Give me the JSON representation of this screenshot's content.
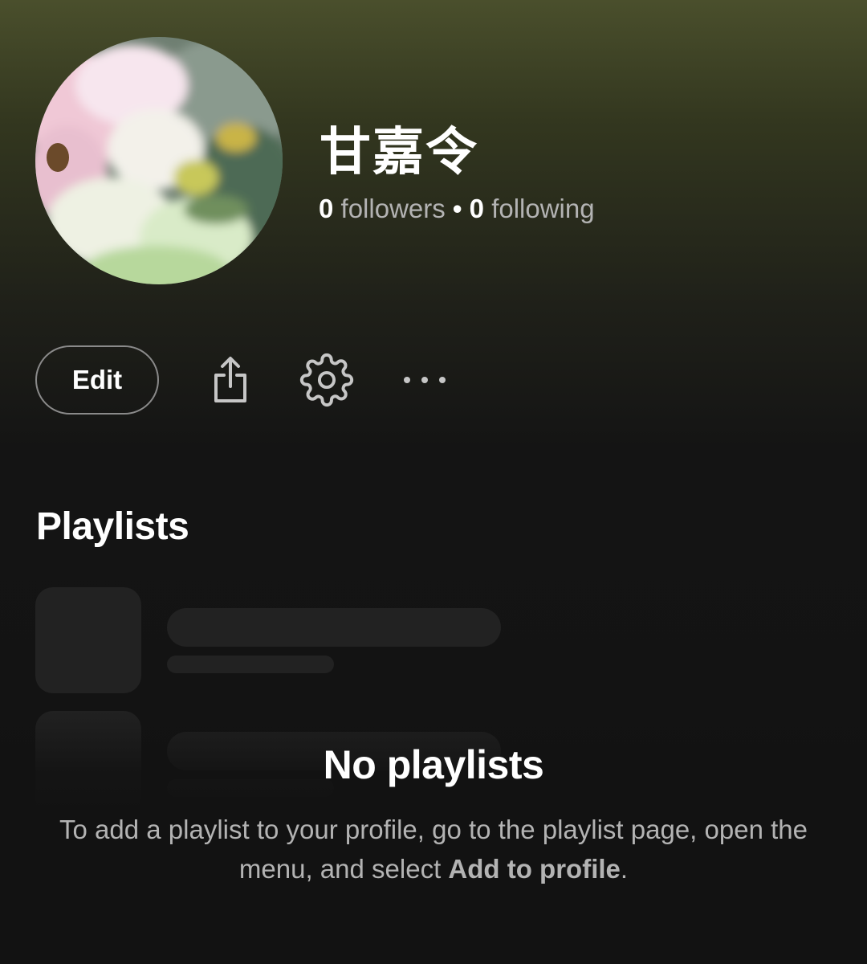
{
  "profile": {
    "display_name": "甘嘉令",
    "followers_count": "0",
    "followers_label": "followers",
    "separator": "•",
    "following_count": "0",
    "following_label": "following",
    "avatar_description_icon": "flower-photo-avatar"
  },
  "actions": {
    "edit_label": "Edit",
    "share_icon": "share-icon",
    "settings_icon": "gear-icon",
    "more_icon": "more-horizontal-icon"
  },
  "playlists": {
    "title": "Playlists",
    "empty_title": "No playlists",
    "empty_desc_before": "To add a playlist to your profile, go to the playlist page, open the menu, and select ",
    "empty_desc_bold": "Add to profile",
    "empty_desc_after": "."
  },
  "colors": {
    "background": "#121212",
    "header_tint": "#4a4f2c",
    "skeleton": "#222222",
    "secondary_text": "#b3b3b3"
  }
}
